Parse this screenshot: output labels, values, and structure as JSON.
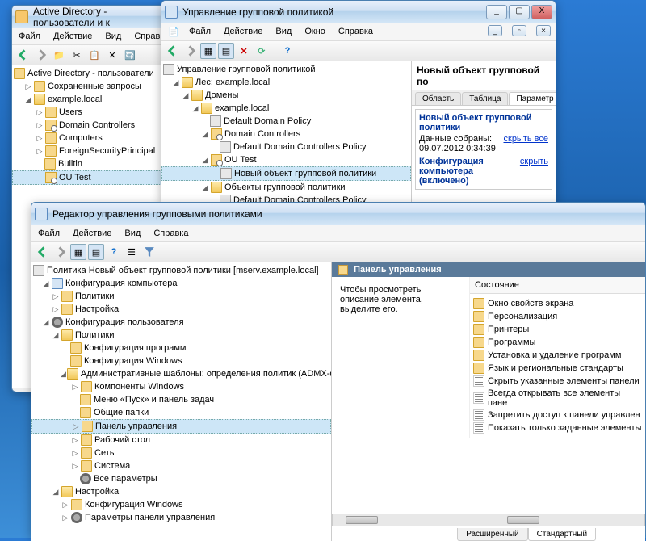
{
  "win_ad": {
    "title": "Active Directory - пользователи и к",
    "menu": [
      "Файл",
      "Действие",
      "Вид",
      "Справка"
    ],
    "root": "Active Directory - пользователи",
    "nodes": {
      "saved": "Сохраненные запросы",
      "domain": "example.local",
      "users": "Users",
      "dc": "Domain Controllers",
      "computers": "Computers",
      "fsp": "ForeignSecurityPrincipal",
      "builtin": "Builtin",
      "outest": "OU Test"
    }
  },
  "win_gpmc": {
    "title": "Управление групповой политикой",
    "menu": [
      "Файл",
      "Действие",
      "Вид",
      "Окно",
      "Справка"
    ],
    "root": "Управление групповой политикой",
    "forest": "Лес: example.local",
    "domains": "Домены",
    "domain": "example.local",
    "ddp": "Default Domain Policy",
    "dc": "Domain Controllers",
    "ddcp": "Default Domain Controllers Policy",
    "outest": "OU Test",
    "newgpo": "Новый объект групповой политики",
    "gpo_container": "Объекты групповой политики",
    "ddcp2": "Default Domain Controllers Policy",
    "detail_title": "Новый объект групповой по",
    "tabs": [
      "Область",
      "Таблица",
      "Параметр"
    ],
    "box_title": "Новый объект групповой политики",
    "box_collected": "Данные собраны:",
    "box_date": "09.07.2012 0:34:39",
    "box_hideall": "скрыть все",
    "box_compconf": "Конфигурация компьютера (включено)",
    "box_hide": "скрыть"
  },
  "win_gpe": {
    "title": "Редактор управления групповыми политиками",
    "menu": [
      "Файл",
      "Действие",
      "Вид",
      "Справка"
    ],
    "root": "Политика Новый объект групповой политики [mserv.example.local]",
    "comp_conf": "Конфигурация компьютера",
    "policies": "Политики",
    "settings": "Настройка",
    "user_conf": "Конфигурация пользователя",
    "prog_conf": "Конфигурация программ",
    "win_conf": "Конфигурация Windows",
    "admx": "Административные шаблоны: определения политик (ADMX-фа",
    "comp_win": "Компоненты Windows",
    "startmenu": "Меню «Пуск» и панель задач",
    "shared": "Общие папки",
    "cpanel": "Панель управления",
    "desktop": "Рабочий стол",
    "network": "Сеть",
    "system": "Система",
    "all": "Все параметры",
    "cpanel_params": "Параметры панели управления",
    "right_title": "Панель управления",
    "right_hint": "Чтобы просмотреть описание элемента, выделите его.",
    "col_state": "Состояние",
    "items": [
      {
        "t": "folder",
        "label": "Окно свойств экрана"
      },
      {
        "t": "folder",
        "label": "Персонализация"
      },
      {
        "t": "folder",
        "label": "Принтеры"
      },
      {
        "t": "folder",
        "label": "Программы"
      },
      {
        "t": "folder",
        "label": "Установка и удаление программ"
      },
      {
        "t": "folder",
        "label": "Язык и региональные стандарты"
      },
      {
        "t": "policy",
        "label": "Скрыть указанные элементы панели"
      },
      {
        "t": "policy",
        "label": "Всегда открывать все элементы пане"
      },
      {
        "t": "policy",
        "label": "Запретить доступ к панели управлен"
      },
      {
        "t": "policy",
        "label": "Показать только заданные элементы"
      }
    ],
    "bottom_tabs": [
      "Расширенный",
      "Стандартный"
    ]
  }
}
